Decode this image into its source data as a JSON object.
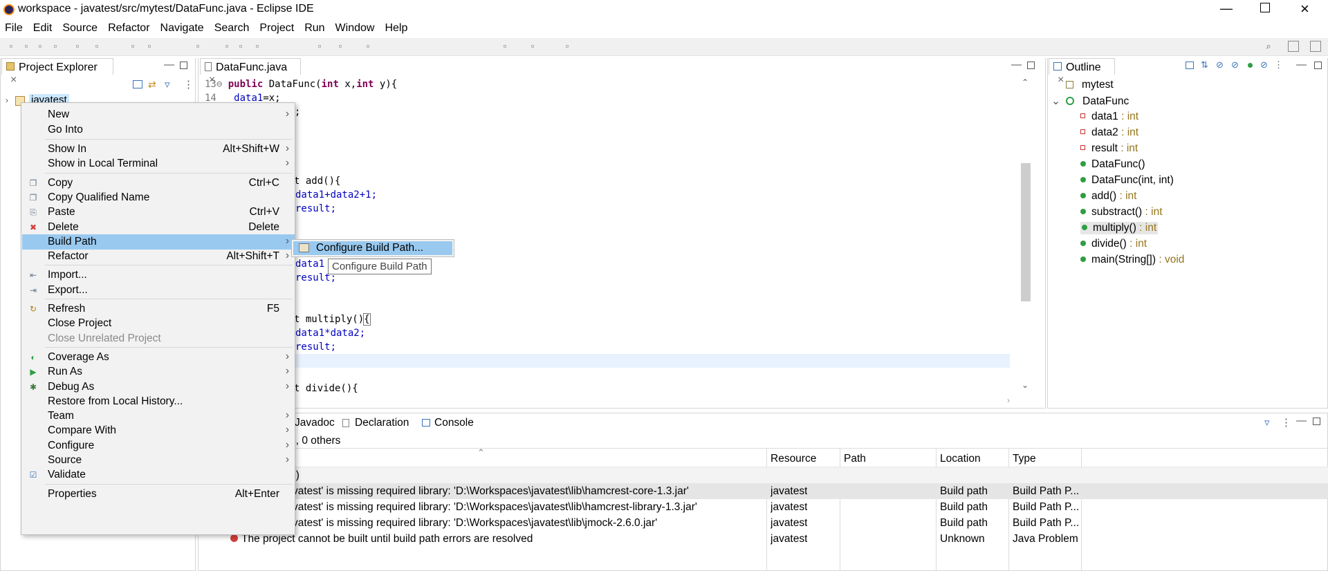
{
  "window": {
    "title": "workspace - javatest/src/mytest/DataFunc.java - Eclipse IDE"
  },
  "menubar": [
    "File",
    "Edit",
    "Source",
    "Refactor",
    "Navigate",
    "Search",
    "Project",
    "Run",
    "Window",
    "Help"
  ],
  "project_explorer": {
    "tab": "Project Explorer",
    "project": "javatest"
  },
  "editor": {
    "tab": "DataFunc.java",
    "lines": [
      {
        "num": "13",
        "code": [
          [
            "kw",
            "public "
          ],
          [
            "",
            "DataFunc("
          ],
          [
            "kw",
            "int "
          ],
          [
            "",
            "x,"
          ],
          [
            "kw",
            "int "
          ],
          [
            "",
            "y){"
          ]
        ]
      },
      {
        "num": "14",
        "code": [
          [
            "fld",
            "data1"
          ],
          [
            "",
            "=x;"
          ]
        ]
      }
    ],
    "fragments": {
      "l15": ";",
      "add_sig": "t add(){",
      "add_b1": "data1+data2+1;",
      "add_b2": "result;",
      "sub_b1": "data1",
      "sub_b2": "result;",
      "mul_sig_a": "t multiply()",
      "mul_sig_b": "{",
      "mul_b1": "data1*data2;",
      "mul_b2": "result;",
      "div_sig": "t divide(){"
    }
  },
  "outline": {
    "tab": "Outline",
    "items": [
      {
        "label": "mytest",
        "type": "",
        "kind": "pkg"
      },
      {
        "label": "DataFunc",
        "type": "",
        "kind": "class"
      },
      {
        "label": "data1",
        "type": " : int",
        "kind": "field"
      },
      {
        "label": "data2",
        "type": " : int",
        "kind": "field"
      },
      {
        "label": "result",
        "type": " : int",
        "kind": "field"
      },
      {
        "label": "DataFunc()",
        "type": "",
        "kind": "ctor"
      },
      {
        "label": "DataFunc(int, int)",
        "type": "",
        "kind": "ctor"
      },
      {
        "label": "add()",
        "type": " : int",
        "kind": "method"
      },
      {
        "label": "substract()",
        "type": " : int",
        "kind": "method"
      },
      {
        "label": "multiply()",
        "type": " : int",
        "kind": "method",
        "selected": true
      },
      {
        "label": "divide()",
        "type": " : int",
        "kind": "method"
      },
      {
        "label": "main(String[])",
        "type": " : void",
        "kind": "static"
      }
    ]
  },
  "context_menu": [
    {
      "label": "New",
      "shortcut": "",
      "submenu": true
    },
    {
      "label": "Go Into",
      "shortcut": ""
    },
    {
      "sep": true
    },
    {
      "label": "Show In",
      "shortcut": "Alt+Shift+W",
      "submenu": true
    },
    {
      "label": "Show in Local Terminal",
      "shortcut": "",
      "submenu": true
    },
    {
      "sep": true
    },
    {
      "label": "Copy",
      "shortcut": "Ctrl+C",
      "icon": "copy-icon"
    },
    {
      "label": "Copy Qualified Name",
      "shortcut": "",
      "icon": "copy-qualified-icon"
    },
    {
      "label": "Paste",
      "shortcut": "Ctrl+V",
      "icon": "paste-icon"
    },
    {
      "label": "Delete",
      "shortcut": "Delete",
      "icon": "delete-icon"
    },
    {
      "label": "Build Path",
      "shortcut": "",
      "submenu": true,
      "selected": true
    },
    {
      "label": "Refactor",
      "shortcut": "Alt+Shift+T",
      "submenu": true
    },
    {
      "sep": true
    },
    {
      "label": "Import...",
      "shortcut": "",
      "icon": "import-icon"
    },
    {
      "label": "Export...",
      "shortcut": "",
      "icon": "export-icon"
    },
    {
      "sep": true
    },
    {
      "label": "Refresh",
      "shortcut": "F5",
      "icon": "refresh-icon"
    },
    {
      "label": "Close Project",
      "shortcut": ""
    },
    {
      "label": "Close Unrelated Project",
      "shortcut": "",
      "disabled": true
    },
    {
      "sep": true
    },
    {
      "label": "Coverage As",
      "shortcut": "",
      "submenu": true,
      "icon": "coverage-icon"
    },
    {
      "label": "Run As",
      "shortcut": "",
      "submenu": true,
      "icon": "run-icon"
    },
    {
      "label": "Debug As",
      "shortcut": "",
      "submenu": true,
      "icon": "debug-icon"
    },
    {
      "label": "Restore from Local History...",
      "shortcut": ""
    },
    {
      "label": "Team",
      "shortcut": "",
      "submenu": true
    },
    {
      "label": "Compare With",
      "shortcut": "",
      "submenu": true
    },
    {
      "label": "Configure",
      "shortcut": "",
      "submenu": true
    },
    {
      "label": "Source",
      "shortcut": "",
      "submenu": true
    },
    {
      "label": "Validate",
      "shortcut": "",
      "icon": "validate-check-icon"
    },
    {
      "sep": true
    },
    {
      "label": "Properties",
      "shortcut": "Alt+Enter"
    }
  ],
  "submenu": {
    "label": "Configure Build Path..."
  },
  "tooltip": "Configure Build Path",
  "bottom": {
    "tabs": [
      "Javadoc",
      "Declaration",
      "Console"
    ],
    "summary": "s, 0 others",
    "columns": [
      "Resource",
      "Path",
      "Location",
      "Type"
    ],
    "group": "s)",
    "rows": [
      {
        "desc": "vatest' is missing required library: 'D:\\Workspaces\\javatest\\lib\\hamcrest-core-1.3.jar'",
        "resource": "javatest",
        "path": "",
        "location": "Build path",
        "type": "Build Path P..."
      },
      {
        "desc": "vatest' is missing required library: 'D:\\Workspaces\\javatest\\lib\\hamcrest-library-1.3.jar'",
        "resource": "javatest",
        "path": "",
        "location": "Build path",
        "type": "Build Path P..."
      },
      {
        "desc": "vatest' is missing required library: 'D:\\Workspaces\\javatest\\lib\\jmock-2.6.0.jar'",
        "resource": "javatest",
        "path": "",
        "location": "Build path",
        "type": "Build Path P..."
      },
      {
        "desc": "The project cannot be built until build path errors are resolved",
        "resource": "javatest",
        "path": "",
        "location": "Unknown",
        "type": "Java Problem"
      }
    ]
  }
}
